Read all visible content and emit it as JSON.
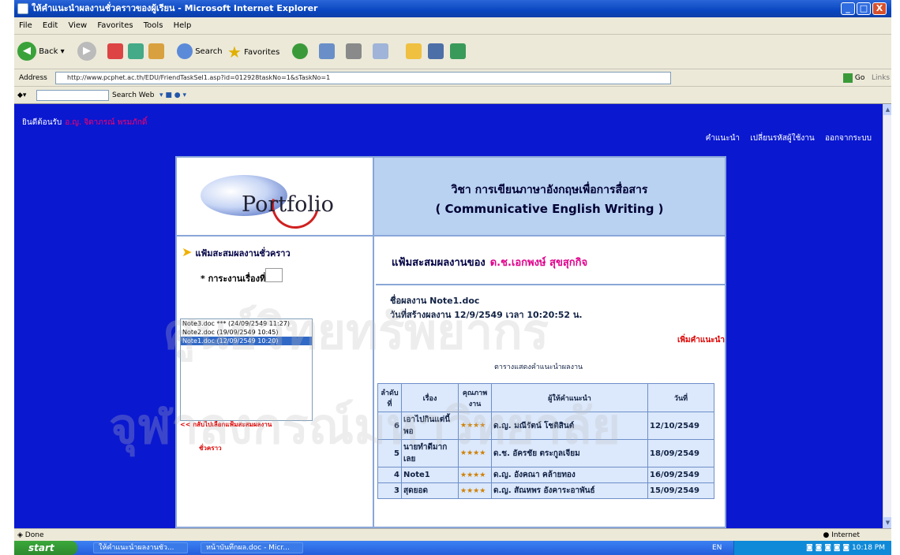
{
  "window": {
    "title": "ให้คำแนะนำผลงานชั่วคราวของผู้เรียน - Microsoft Internet Explorer",
    "minimize": "_",
    "maximize": "□",
    "close": "X"
  },
  "menu": [
    "File",
    "Edit",
    "View",
    "Favorites",
    "Tools",
    "Help"
  ],
  "toolbar": {
    "back_label": "Back",
    "search_label": "Search",
    "favorites_label": "Favorites"
  },
  "address": {
    "label": "Address",
    "url": "http://www.pcphet.ac.th/EDU/FriendTaskSel1.asp?id=012928taskNo=1&sTaskNo=1",
    "go_label": "Go",
    "links_label": "Links"
  },
  "links_bar": {
    "search_label": "Search Web"
  },
  "page": {
    "welcome": "ยินดีต้อนรับ",
    "welcome_name": "อ.ญ. จิดาภรณ์ พรมภักดิ์",
    "nav": [
      "คำแนะนำ",
      "เปลี่ยนรหัสผู้ใช้งาน",
      "ออกจากระบบ"
    ],
    "logo_text": "Portfolio",
    "course_line1": "วิชา การเขียนภาษาอังกฤษเพื่อการสื่อสาร",
    "course_line2": "( Communicative English Writing )",
    "left_heading": "แฟ้มสะสมผลงานชั่วคราว",
    "task_label": "* การะงานเรื่องที่",
    "files": [
      "Note3.doc *** (24/09/2549 11:27)",
      "Note2.doc (19/09/2549 10:45)",
      "Note1.doc (12/09/2549 10:20)"
    ],
    "back_link": "<< กลับไปเลือกแฟ้มสะสมผลงาน",
    "back_link2": "ชั่วคราว",
    "portfolio_heading": "แฟ้มสะสมผลงานของ",
    "portfolio_owner": "ด.ช.เอกพงษ์ สุขสุกกิจ",
    "file_name_line": "ชื่อผลงาน Note1.doc",
    "created_line": "วันที่สร้างผลงาน 12/9/2549   เวลา 10:20:52  น.",
    "add_comment": "เพิ่มคำแนะนำ",
    "table_caption": "ตารางแสดงคำแนะนำผลงาน",
    "table_headers": [
      "ลำดับที่",
      "เรื่อง",
      "คุณภาพงาน",
      "ผู้ให้คำแนะนำ",
      "วันที่"
    ],
    "table_rows": [
      {
        "no": "6",
        "subject": "เอาไปกินแต่นี้พอ",
        "stars": "★★★★",
        "advisor": "ด.ญ. มณีรัตน์ โชติสินต์",
        "date": "12/10/2549"
      },
      {
        "no": "5",
        "subject": "นายทำดีมากเลย",
        "stars": "★★★★",
        "advisor": "ด.ช. อัครชัย ตระกูลเจียม",
        "date": "18/09/2549"
      },
      {
        "no": "4",
        "subject": "Note1",
        "stars": "★★★★",
        "advisor": "ด.ญ. อังคณา คล้ายทอง",
        "date": "16/09/2549"
      },
      {
        "no": "3",
        "subject": "สุดยอด",
        "stars": "★★★★",
        "advisor": "ด.ญ. สัณหพร อังคาระอาพันธ์",
        "date": "15/09/2549"
      }
    ]
  },
  "status": {
    "left": "Done",
    "right": "Internet"
  },
  "taskbar": {
    "start": "start",
    "item1": "ให้คำแนะนำผลงานชั่ว...",
    "item2": "หน้าบันทึกผล.doc - Micr...",
    "lang": "EN",
    "clock": "10:18 PM"
  }
}
